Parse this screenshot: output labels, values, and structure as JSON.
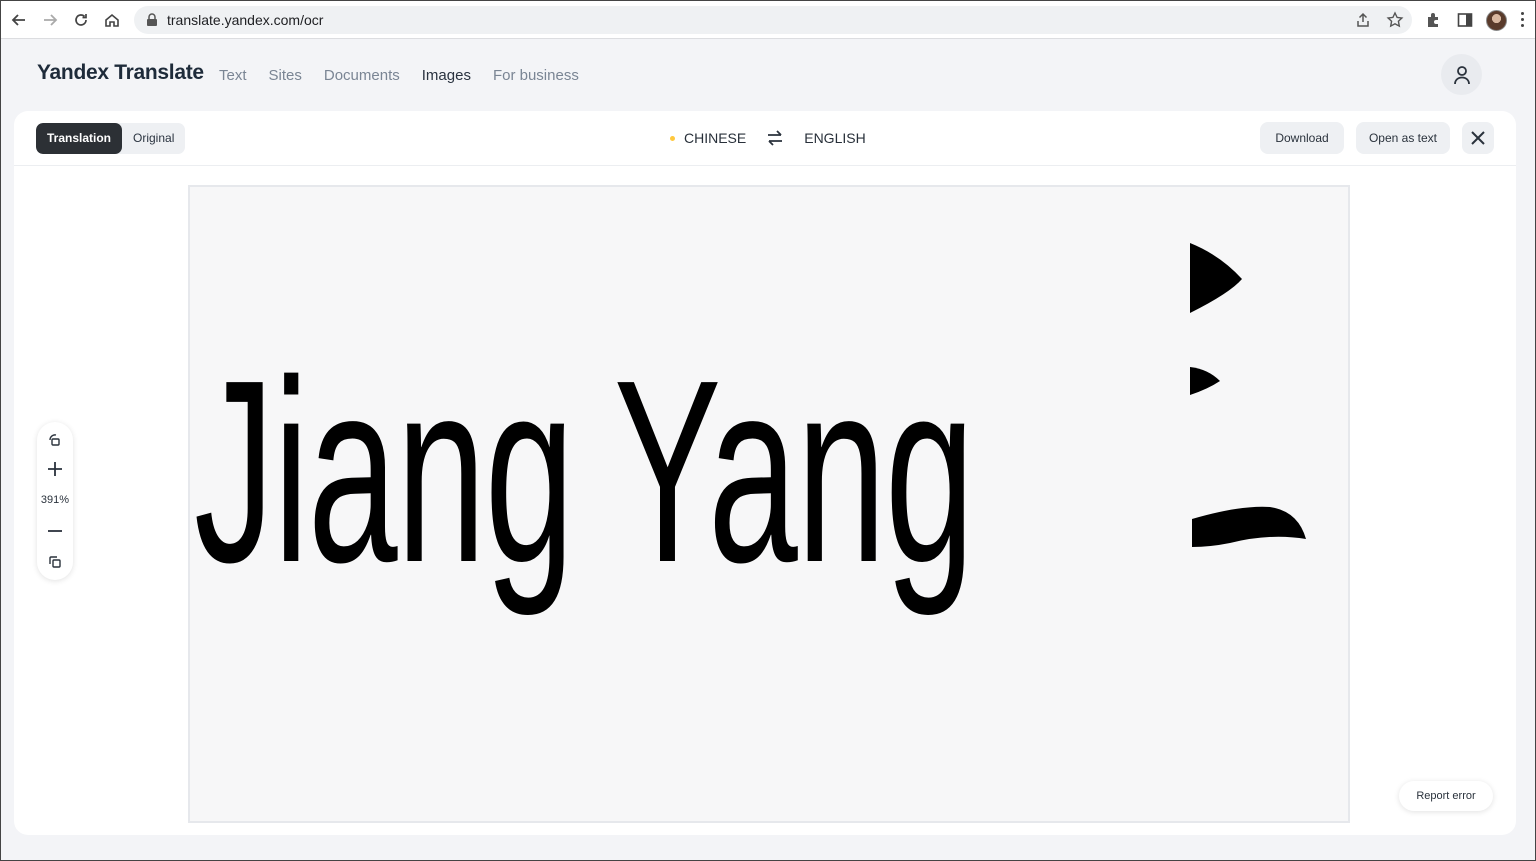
{
  "browser": {
    "url": "translate.yandex.com/ocr"
  },
  "header": {
    "logo": "Yandex Translate",
    "nav": [
      {
        "label": "Text"
      },
      {
        "label": "Sites"
      },
      {
        "label": "Documents"
      },
      {
        "label": "Images"
      },
      {
        "label": "For business"
      }
    ],
    "active_nav": "Images"
  },
  "toolbar": {
    "mode_translation": "Translation",
    "mode_original": "Original",
    "source_lang": "CHINESE",
    "target_lang": "ENGLISH",
    "download_label": "Download",
    "open_as_text_label": "Open as text"
  },
  "viewer": {
    "translated_text": "Jiang Yang",
    "zoom_level": "391%",
    "report_error_label": "Report error"
  },
  "colors": {
    "accent_dot": "#ffc83d",
    "selected_toggle": "#2c3035"
  }
}
